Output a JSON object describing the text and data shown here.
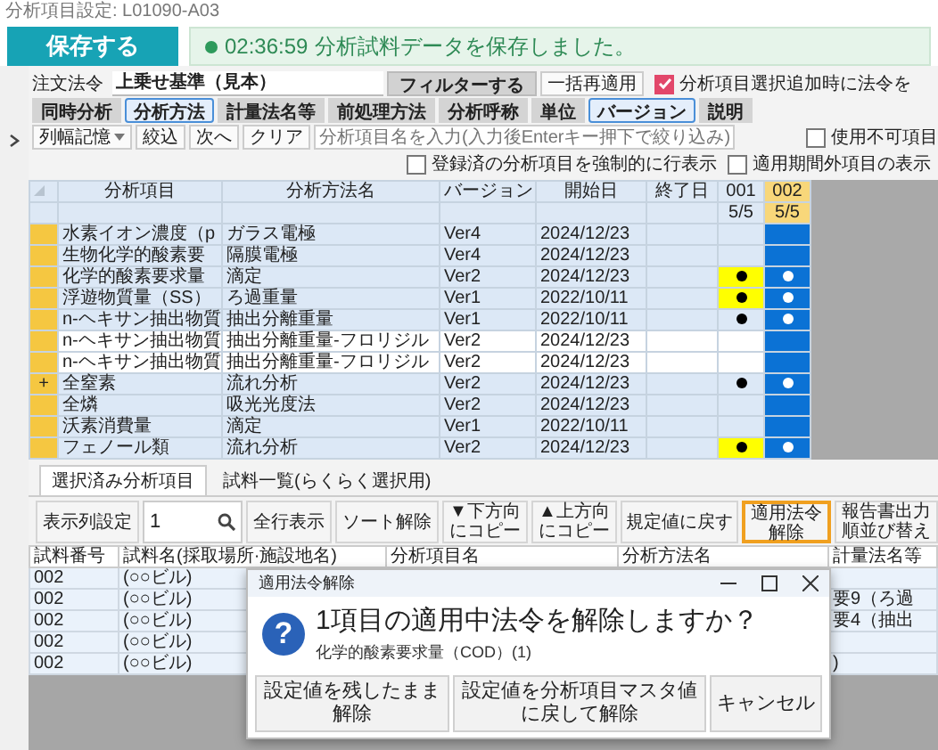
{
  "window": {
    "title": "分析項目設定: L01090-A03"
  },
  "save_button": "保存する",
  "status": {
    "time": "02:36:59",
    "message": "分析試料データを保存しました。"
  },
  "law": {
    "label": "注文法令",
    "value": "上乗せ基準（見本）"
  },
  "filter_button": "フィルターする",
  "reapply_button": "一括再適用",
  "options": [
    {
      "label": "分析項目選択追加時に法令を",
      "checked": true
    },
    {
      "label": "使用不可項目",
      "checked": false
    },
    {
      "label": "登録済の分析項目を強制的に行表示",
      "checked": false
    },
    {
      "label": "適用期間外項目の表示",
      "checked": false
    }
  ],
  "column_toggles": [
    {
      "label": "同時分析",
      "selected": false
    },
    {
      "label": "分析方法",
      "selected": true
    },
    {
      "label": "計量法名等",
      "selected": false
    },
    {
      "label": "前処理方法",
      "selected": false
    },
    {
      "label": "分析呼称",
      "selected": false
    },
    {
      "label": "単位",
      "selected": false
    },
    {
      "label": "バージョン",
      "selected": true
    },
    {
      "label": "説明",
      "selected": false
    }
  ],
  "column_width_menu": "列幅記憶",
  "search_buttons": [
    "絞込",
    "次へ",
    "クリア"
  ],
  "search": {
    "placeholder": "分析項目名を入力(入力後Enterキー押下で絞り込み)"
  },
  "grid": {
    "columns": [
      "分析項目",
      "分析方法名",
      "バージョン",
      "開始日",
      "終了日"
    ],
    "sample_columns": [
      {
        "label": "001",
        "count": "5/5",
        "selected": false
      },
      {
        "label": "002",
        "count": "5/5",
        "selected": true
      }
    ],
    "rows": [
      {
        "item": "水素イオン濃度（p",
        "method": "ガラス電極",
        "version": "Ver4",
        "start": "2024/12/23",
        "shaded": true,
        "cells": [
          {
            "dot": false,
            "highlight": false
          },
          {
            "dot": false,
            "highlight": false
          }
        ]
      },
      {
        "item": "生物化学的酸素要",
        "method": "隔膜電極",
        "version": "Ver4",
        "start": "2024/12/23",
        "shaded": true,
        "cells": [
          {
            "dot": false,
            "highlight": false
          },
          {
            "dot": false,
            "highlight": false
          }
        ]
      },
      {
        "item": "化学的酸素要求量",
        "method": "滴定",
        "version": "Ver2",
        "start": "2024/12/23",
        "shaded": true,
        "cells": [
          {
            "dot": true,
            "highlight": true
          },
          {
            "dot": true,
            "highlight": false
          }
        ]
      },
      {
        "item": "浮遊物質量（SS）",
        "method": "ろ過重量",
        "version": "Ver1",
        "start": "2022/10/11",
        "shaded": true,
        "cells": [
          {
            "dot": true,
            "highlight": true
          },
          {
            "dot": true,
            "highlight": false
          }
        ]
      },
      {
        "item": "n-ヘキサン抽出物質",
        "method": "抽出分離重量",
        "version": "Ver1",
        "start": "2022/10/11",
        "shaded": true,
        "cells": [
          {
            "dot": true,
            "highlight": false
          },
          {
            "dot": true,
            "highlight": false
          }
        ]
      },
      {
        "item": "n-ヘキサン抽出物質",
        "method": "抽出分離重量-フロリジル",
        "version": "Ver2",
        "start": "2024/12/23",
        "shaded": false,
        "cells": [
          {
            "dot": false,
            "highlight": false
          },
          {
            "dot": false,
            "highlight": false
          }
        ]
      },
      {
        "item": "n-ヘキサン抽出物質",
        "method": "抽出分離重量-フロリジル",
        "version": "Ver2",
        "start": "2024/12/23",
        "shaded": false,
        "cells": [
          {
            "dot": false,
            "highlight": false
          },
          {
            "dot": false,
            "highlight": false
          }
        ]
      },
      {
        "marker": "+",
        "item": "全窒素",
        "method": "流れ分析",
        "version": "Ver2",
        "start": "2024/12/23",
        "shaded": true,
        "cells": [
          {
            "dot": true,
            "highlight": false
          },
          {
            "dot": true,
            "highlight": false
          }
        ]
      },
      {
        "item": "全燐",
        "method": "吸光光度法",
        "version": "Ver2",
        "start": "2024/12/23",
        "shaded": true,
        "cells": [
          {
            "dot": false,
            "highlight": false
          },
          {
            "dot": false,
            "highlight": false
          }
        ]
      },
      {
        "item": "沃素消費量",
        "method": "滴定",
        "version": "Ver1",
        "start": "2022/10/11",
        "shaded": true,
        "cells": [
          {
            "dot": false,
            "highlight": false
          },
          {
            "dot": false,
            "highlight": false
          }
        ]
      },
      {
        "item": "フェノール類",
        "method": "流れ分析",
        "version": "Ver2",
        "start": "2024/12/23",
        "shaded": true,
        "cells": [
          {
            "dot": true,
            "highlight": true
          },
          {
            "dot": true,
            "highlight": false
          }
        ]
      }
    ]
  },
  "tabs": [
    {
      "label": "選択済み分析項目",
      "selected": true
    },
    {
      "label": "試料一覧(らくらく選択用)",
      "selected": false
    }
  ],
  "toolbar": {
    "settings_button": "表示列設定",
    "search_value": "1",
    "buttons": [
      {
        "label": "全行表示",
        "highlighted": false
      },
      {
        "label": "ソート解除",
        "highlighted": false
      },
      {
        "label": "▼下方向にコピー",
        "highlighted": false
      },
      {
        "label": "▲上方向にコピー",
        "highlighted": false
      },
      {
        "label": "規定値に戻す",
        "highlighted": false
      },
      {
        "label": "適用法令解除",
        "highlighted": true
      },
      {
        "label": "報告書出力順並び替え",
        "highlighted": false
      }
    ]
  },
  "samples": {
    "columns": [
      "試料番号",
      "試料名(採取場所·施設地名)",
      "分析項目名",
      "分析方法名",
      "計量法名等"
    ],
    "rows": [
      {
        "number": "002",
        "name": "(○○ビル)"
      },
      {
        "number": "002",
        "name": "(○○ビル)",
        "column_5": "要9（ろ過"
      },
      {
        "number": "002",
        "name": "(○○ビル)",
        "column_5": "要4（抽出"
      },
      {
        "number": "002",
        "name": "(○○ビル)"
      },
      {
        "number": "002",
        "name": "(○○ビル)",
        "column_5": ")"
      }
    ]
  },
  "dialog": {
    "title": "適用法令解除",
    "icon": "?",
    "question": "1項目の適用中法令を解除しますか？",
    "detail": "化学的酸素要求量（COD）(1)",
    "buttons": [
      "設定値を残したまま解除",
      "設定値を分析項目マスタ値に戻して解除",
      "キャンセル"
    ]
  }
}
